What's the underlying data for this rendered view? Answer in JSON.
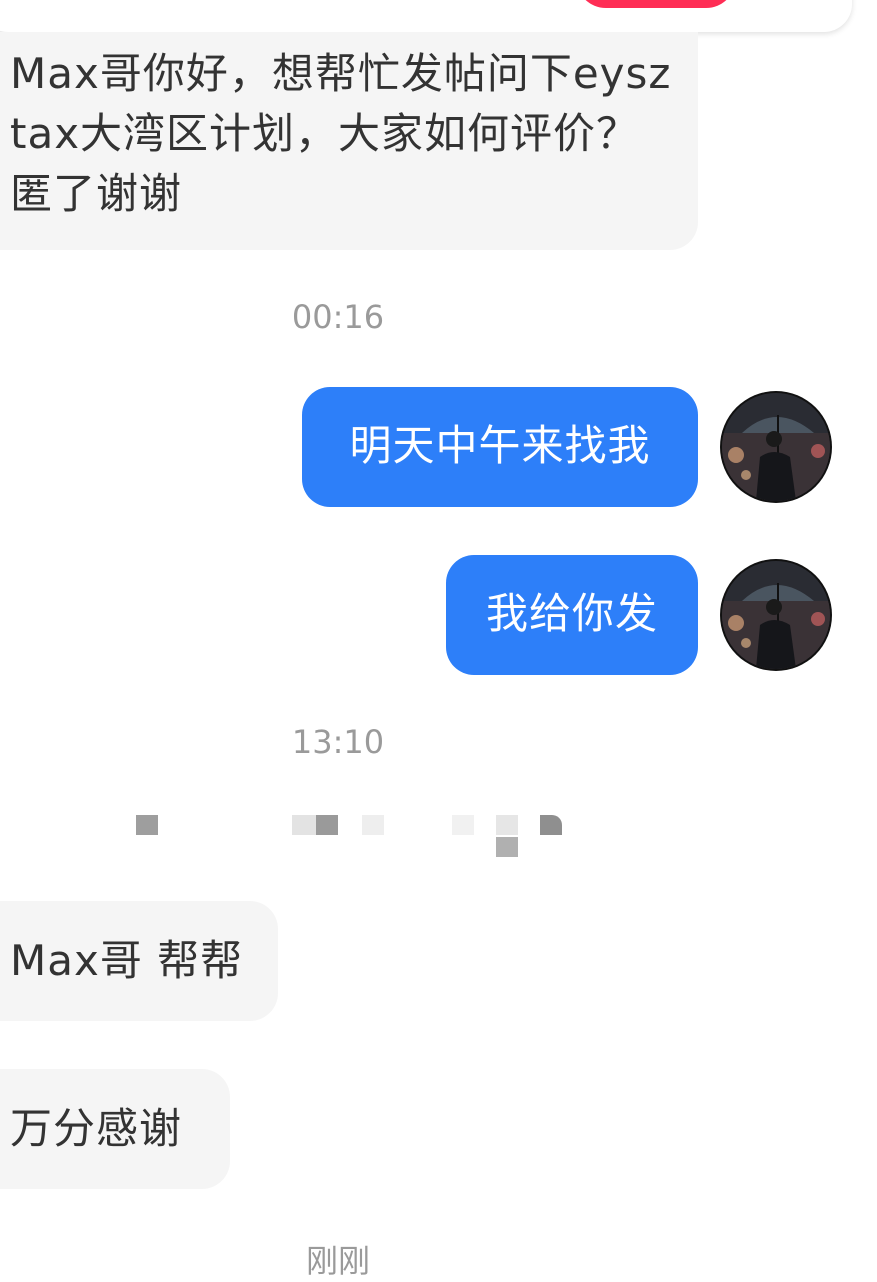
{
  "header": {
    "accent_color": "#ff2d55"
  },
  "messages": [
    {
      "side": "incoming",
      "text": "Max哥你好，想帮忙发帖问下eysz tax大湾区计划，大家如何评价？匿了谢谢"
    },
    {
      "side": "outgoing",
      "text": "明天中午来找我"
    },
    {
      "side": "outgoing",
      "text": "我给你发"
    },
    {
      "side": "incoming",
      "text": "Max哥 帮帮"
    },
    {
      "side": "incoming",
      "text": "万分感谢"
    }
  ],
  "timestamps": [
    "00:16",
    "13:10",
    "刚刚"
  ],
  "avatar": {
    "icon": "umbrella-man-avatar"
  },
  "colors": {
    "outgoing_bubble": "#2d7ff9",
    "incoming_bubble": "#f5f5f5",
    "timestamp_text": "#9a9a9a"
  }
}
